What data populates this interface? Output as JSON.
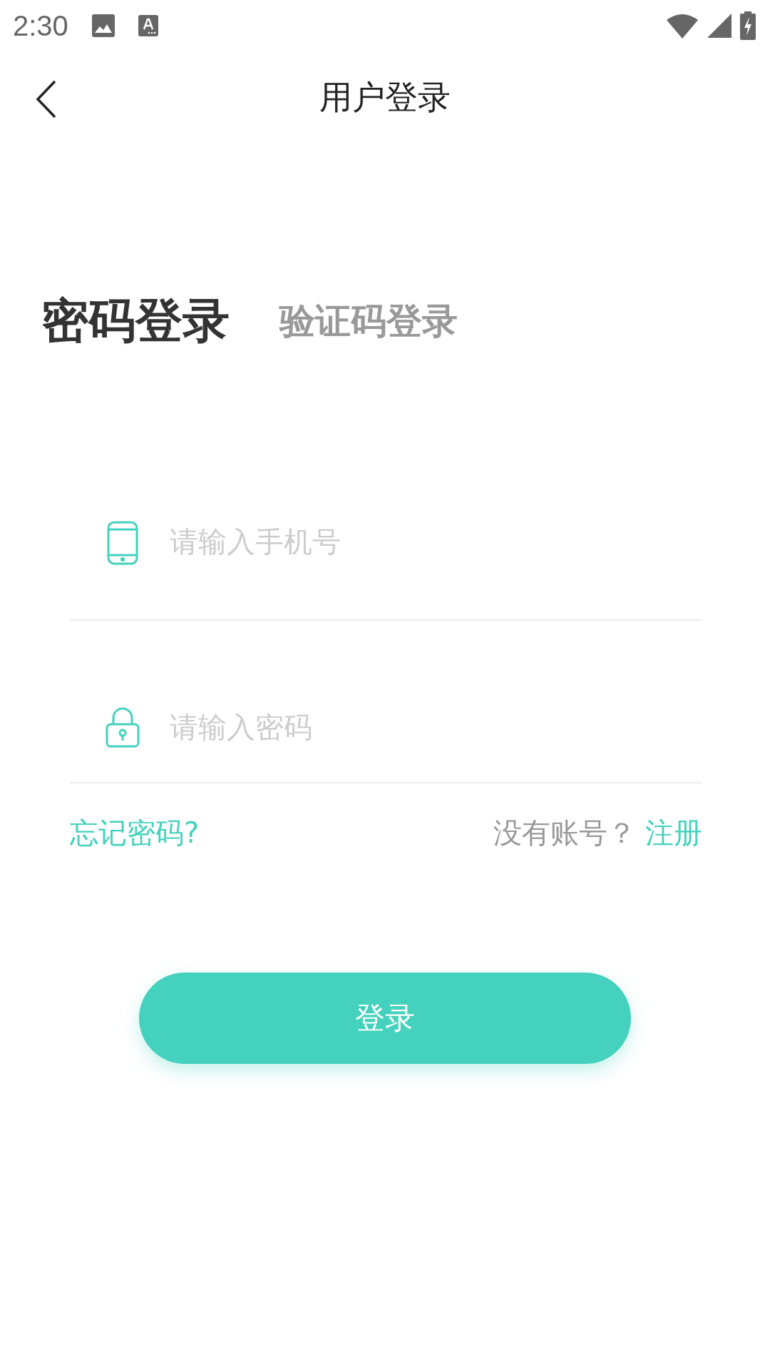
{
  "status_bar": {
    "time": "2:30"
  },
  "header": {
    "title": "用户登录"
  },
  "tabs": [
    {
      "label": "密码登录",
      "selected": true
    },
    {
      "label": "验证码登录",
      "selected": false
    }
  ],
  "fields": [
    {
      "kind": "phone",
      "placeholder": "请输入手机号"
    },
    {
      "kind": "password",
      "placeholder": "请输入密码"
    }
  ],
  "links": {
    "forgot": "忘记密码?",
    "no_account": "没有账号？",
    "register": "注册"
  },
  "login_button": "登录"
}
